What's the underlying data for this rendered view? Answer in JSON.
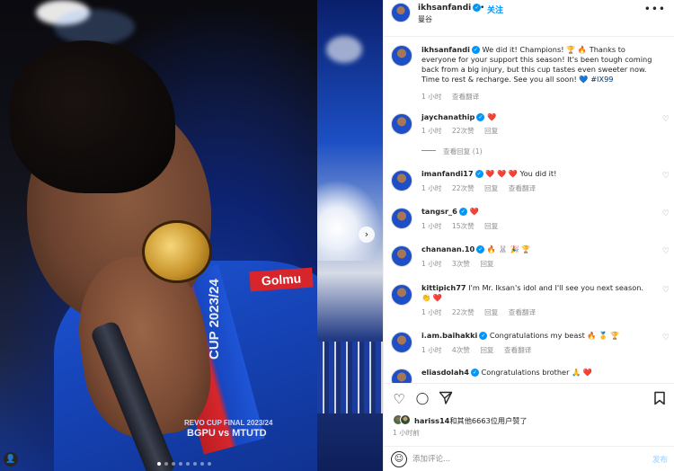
{
  "media": {
    "sponsor_text": "Golmu",
    "cup_text": "CUP 2023/24",
    "final_text": "REVO CUP FINAL 2023/24",
    "match_text": "BGPU vs MTUTD",
    "stadium_text": "",
    "carousel_count": 8,
    "carousel_active": 0
  },
  "header": {
    "username": "ikhsanfandi",
    "separator": "•",
    "follow_label": "关注",
    "location": "曼谷",
    "more_icon": "more-horizontal-icon"
  },
  "caption": {
    "username": "ikhsanfandi",
    "text": " We did it! Champions! 🏆 🔥 Thanks to everyone for your support this season! It's been tough coming back from a big injury, but this cup tastes even sweeter now. Time to rest & recharge. See you all soon! 💙 ",
    "hashtag": "#IX99",
    "time": "1 小时",
    "translate": "查看翻译"
  },
  "comments": [
    {
      "username": "jaychanathip",
      "text": " ❤️",
      "time": "1 小时",
      "likes": "22次赞",
      "reply": "回复",
      "translate": "",
      "replies": "查看回复 (1)"
    },
    {
      "username": "imanfandi17",
      "text": " ❤️ ❤️ ❤️ You did it!",
      "time": "1 小时",
      "likes": "22次赞",
      "reply": "回复",
      "translate": "查看翻译",
      "replies": ""
    },
    {
      "username": "tangsr_6",
      "text": " ❤️",
      "time": "1 小时",
      "likes": "15次赞",
      "reply": "回复",
      "translate": "",
      "replies": ""
    },
    {
      "username": "chananan.10",
      "text": " 🔥 🐰 🎉 🏆",
      "time": "1 小时",
      "likes": "3次赞",
      "reply": "回复",
      "translate": "",
      "replies": ""
    },
    {
      "username": "kittipich77",
      "text": " I'm Mr. Iksan's idol and I'll see you next season. 👏 ❤️",
      "time": "1 小时",
      "likes": "22次赞",
      "reply": "回复",
      "translate": "查看翻译",
      "replies": ""
    },
    {
      "username": "i.am.baihakki",
      "text": " Congratulations my beast 🔥 🥇 🏆",
      "time": "1 小时",
      "likes": "4次赞",
      "reply": "回复",
      "translate": "查看翻译",
      "replies": ""
    },
    {
      "username": "eliasdolah4",
      "text": " Congratulations brother 🙏 ❤️",
      "time": "",
      "likes": "",
      "reply": "",
      "translate": "",
      "replies": ""
    }
  ],
  "actions": {
    "like_icon": "heart-outline-icon",
    "comment_icon": "comment-bubble-icon",
    "share_icon": "paper-plane-icon",
    "save_icon": "bookmark-icon"
  },
  "likes": {
    "user": "hariss14",
    "rest": "和其他6663位用户赞了",
    "time": "1 小时前"
  },
  "composer": {
    "placeholder": "添加评论...",
    "post_label": "发布"
  }
}
